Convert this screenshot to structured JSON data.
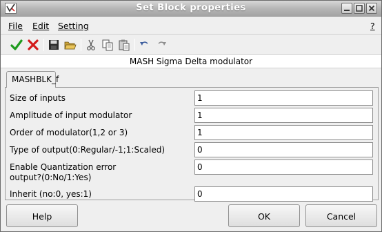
{
  "window": {
    "title": "Set Block properties"
  },
  "menu": {
    "file": "File",
    "edit": "Edit",
    "setting": "Setting",
    "help": "?"
  },
  "toolbar": {
    "icons": [
      "ok-icon",
      "cancel-icon",
      "save-icon",
      "open-icon",
      "cut-icon",
      "copy-icon",
      "paste-icon",
      "undo-icon",
      "redo-icon"
    ]
  },
  "block": {
    "description": "MASH Sigma Delta modulator",
    "tab": "MASHBLK_f"
  },
  "fields": [
    {
      "label": "Size of inputs",
      "value": "1"
    },
    {
      "label": "Amplitude of input modulator",
      "value": "1"
    },
    {
      "label": "Order of modulator(1,2 or 3)",
      "value": "1"
    },
    {
      "label": "Type of output(0:Regular/-1;1:Scaled)",
      "value": "0"
    },
    {
      "label_line1": "Enable Quantization error",
      "label_line2": "output?(0:No/1:Yes)",
      "value": "0"
    },
    {
      "label": "Inherit (no:0, yes:1)",
      "value": "0"
    }
  ],
  "buttons": {
    "help": "Help",
    "ok": "OK",
    "cancel": "Cancel"
  }
}
